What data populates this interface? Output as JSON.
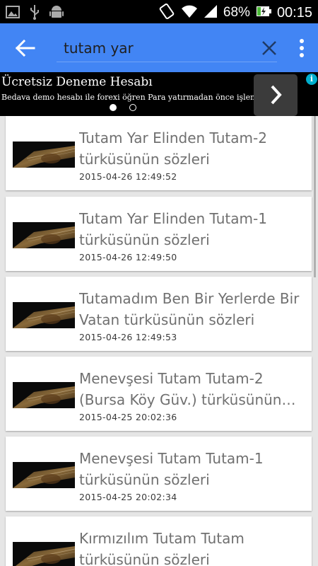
{
  "status_bar": {
    "left_icons": [
      "image-icon",
      "usb-icon",
      "android-icon"
    ],
    "right_icons": [
      "vibrate-icon",
      "wifi-icon",
      "signal-icon"
    ],
    "battery_percent": "68%",
    "time": "00:15"
  },
  "search": {
    "query": "tutam yar",
    "back_icon": "arrow-left-icon",
    "clear_icon": "close-icon",
    "menu_icon": "more-vert-icon"
  },
  "ad": {
    "title": "Ücretsiz Deneme Hesabı",
    "description": "Bedava demo hesabı ile forexi öğren Para yatırmadan önce işlem yap",
    "page_count": 2,
    "active_page": 0,
    "info_label": "i"
  },
  "results": [
    {
      "title_line1": "Tutam Yar Elinden Tutam-2",
      "title_line2": "türküsünün sözleri",
      "date": "2015-04-26 12:49:52"
    },
    {
      "title_line1": "Tutam Yar Elinden Tutam-1",
      "title_line2": "türküsünün sözleri",
      "date": "2015-04-26 12:49:50"
    },
    {
      "title_line1": "Tutamadım Ben Bir Yerlerde Bir",
      "title_line2": "Vatan türküsünün sözleri",
      "date": "2015-04-26 12:49:53"
    },
    {
      "title_line1": "Menevşesi Tutam Tutam-2",
      "title_line2": "(Bursa Köy Güv.) türküsünün…",
      "date": "2015-04-25 20:02:36"
    },
    {
      "title_line1": "Menevşesi Tutam Tutam-1",
      "title_line2": "türküsünün sözleri",
      "date": "2015-04-25 20:02:34"
    },
    {
      "title_line1": "Kırmızılım Tutam Tutam",
      "title_line2": "türküsünün sözleri",
      "date": ""
    }
  ],
  "colors": {
    "appbar": "#4285f4",
    "title_text": "#707070",
    "date_text": "#3a3a3a"
  }
}
